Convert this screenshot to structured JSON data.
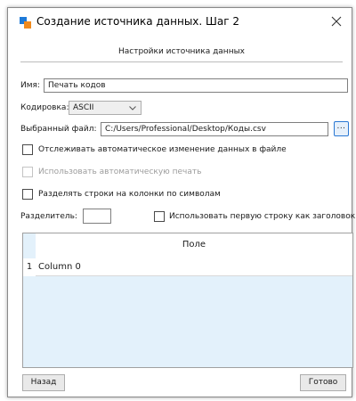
{
  "window": {
    "title": "Создание источника данных. Шаг 2",
    "close_glyph": "×"
  },
  "section_header": "Настройки источника данных",
  "form": {
    "name_label": "Имя:",
    "name_value": "Печать кодов",
    "encoding_label": "Кодировка:",
    "encoding_value": "ASCII",
    "file_label": "Выбранный файл:",
    "file_value": "C:/Users/Professional/Desktop/Коды.csv",
    "browse_label": "...",
    "track_changes_label": "Отслеживать автоматическое изменение данных в файле",
    "track_changes_checked": false,
    "auto_print_label": "Использовать автоматическую печать",
    "auto_print_checked": false,
    "auto_print_enabled": false,
    "split_columns_label": "Разделять строки на колонки по символам",
    "split_columns_checked": false,
    "separator_label": "Разделитель:",
    "separator_value": "",
    "first_row_header_label": "Использовать первую строку как заголовок",
    "first_row_header_checked": false
  },
  "grid": {
    "column_header": "Поле",
    "rows": [
      {
        "num": "1",
        "value": "Column 0"
      }
    ]
  },
  "buttons": {
    "back": "Назад",
    "done": "Готово"
  },
  "colors": {
    "icon_blue": "#1e7ad8",
    "icon_orange": "#f08a1e",
    "grid_fill": "#e3f1fb",
    "browse_border": "#2a78d3"
  }
}
